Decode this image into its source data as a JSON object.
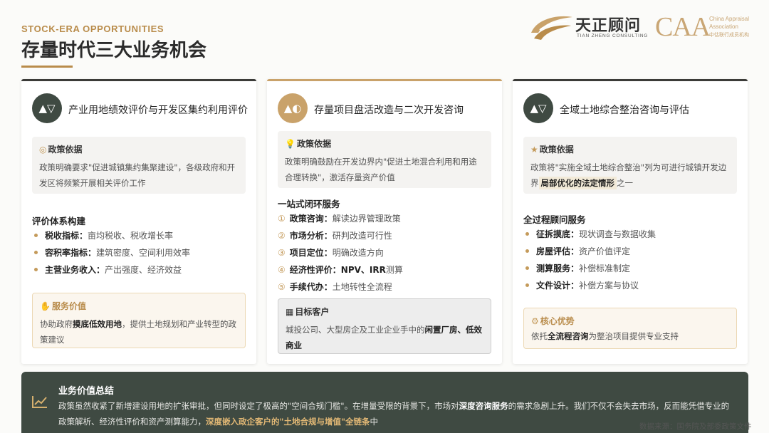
{
  "header": {
    "eyebrow": "STOCK-ERA OPPORTUNITIES",
    "title": "存量时代三大业务机会"
  },
  "logos": {
    "tianzheng_cn": "天正顾问",
    "tianzheng_en": "TIAN ZHENG CONSULTING",
    "caa_abbr": "CAA",
    "caa_line1": "China Appraisal",
    "caa_line2": "Association",
    "caa_line3": "中估联行成员机构"
  },
  "cards": [
    {
      "title": "产业用地绩效评价与开发区集约利用评价",
      "badge_icon": "▲▽",
      "policy_label": "政策依据",
      "policy_text": "政策明确要求\"促进城镇集约集聚建设\"，各级政府和开发区将频繁开展相关评价工作",
      "section_label": "评价体系构建",
      "items": [
        {
          "bold": "税收指标：",
          "text": "亩均税收、税收增长率"
        },
        {
          "bold": "容积率指标：",
          "text": "建筑密度、空间利用效率"
        },
        {
          "bold": "主营业务收入：",
          "text": "产出强度、经济效益"
        }
      ],
      "value_label": "服务价值",
      "value_pre": "协助政府",
      "value_bold": "摸底低效用地",
      "value_post": "，提供土地规划和产业转型的政策建议"
    },
    {
      "title": "存量项目盘活改造与二次开发咨询",
      "badge_icon": "▲◐",
      "policy_label": "政策依据",
      "policy_text": "政策明确鼓励在开发边界内\"促进土地混合利用和用途合理转换\"，激活存量资产价值",
      "section_label": "一站式闭环服务",
      "items": [
        {
          "num": "①",
          "bold": "政策咨询：",
          "text": "解读边界管理政策"
        },
        {
          "num": "②",
          "bold": "市场分析：",
          "text": "研判改造可行性"
        },
        {
          "num": "③",
          "bold": "项目定位：",
          "text": "明确改造方向"
        },
        {
          "num": "④",
          "bold": "经济性评价：",
          "text_bold": "NPV、IRR",
          "text": "测算"
        },
        {
          "num": "⑤",
          "bold": "手续代办：",
          "text": "土地转性全流程"
        }
      ],
      "target_label": "目标客户",
      "target_pre": "城投公司、大型房企及工业企业手中的",
      "target_bold": "闲置厂房、低效商业"
    },
    {
      "title": "全域土地综合整治咨询与评估",
      "badge_icon": "▲▽",
      "policy_label": "政策依据",
      "policy_pre": "政策将\"实施全域土地综合整治\"列为可进行城镇开发边界",
      "policy_hl": "局部优化的法定情形",
      "policy_post": "之一",
      "section_label": "全过程顾问服务",
      "items": [
        {
          "bold": "征拆摸底：",
          "text": "现状调查与数据收集"
        },
        {
          "bold": "房屋评估：",
          "text": "资产价值评定"
        },
        {
          "bold": "测算服务：",
          "text": "补偿标准制定"
        },
        {
          "bold": "文件设计：",
          "text": "补偿方案与协议"
        }
      ],
      "adv_label": "核心优势",
      "adv_pre": "依托",
      "adv_bold": "全流程咨询",
      "adv_post": "为整治项目提供专业支持"
    }
  ],
  "summary": {
    "title": "业务价值总结",
    "text_1": "政策虽然收紧了新增建设用地的扩张审批，但同时设定了极高的\"空间合规门槛\"。在增量受限的背景下，市场对",
    "text_bold": "深度咨询服务",
    "text_2": "的需求急剧上升。我们不仅不会失去市场，反而能凭借专业的政策解析、经济性评价和资产测算能力，",
    "text_gold": "深度嵌入政企客户的\"土地合规与增值\"全链条",
    "text_3": "中"
  },
  "source": "数据来源：国务院及部委政策文件",
  "colors": {
    "accent": "#b98c4b",
    "dark_green": "#3f4a42",
    "gold": "#c9a26a"
  }
}
